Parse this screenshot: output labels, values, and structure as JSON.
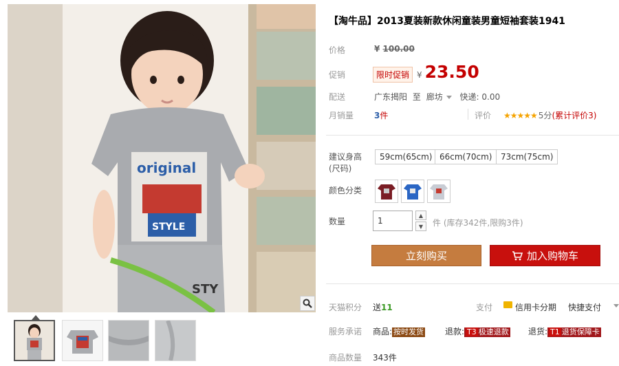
{
  "product": {
    "title": "【淘牛品】2013夏装新款休闲童装男童短袖套装1941"
  },
  "price": {
    "label": "价格",
    "currency": "¥",
    "original": "100.00"
  },
  "promo": {
    "label": "促销",
    "badge": "限时促销",
    "currency": "¥",
    "price": "23.50"
  },
  "shipping": {
    "label": "配送",
    "from": "广东揭阳",
    "to_word": "至",
    "destination": "廊坊",
    "express": "快递: 0.00"
  },
  "sales": {
    "label": "月销量",
    "count": "3",
    "unit": "件",
    "review_label": "评价",
    "stars": "★★★★★",
    "score": "5分",
    "review_count": "(累计评价3)"
  },
  "size": {
    "label": "建议身高(尺码)",
    "options": [
      "59cm(65cm)",
      "66cm(70cm)",
      "73cm(75cm)"
    ]
  },
  "color": {
    "label": "颜色分类",
    "swatches": [
      {
        "name": "maroon-set",
        "color": "#7a1d24"
      },
      {
        "name": "blue-set",
        "color": "#2b66c4"
      },
      {
        "name": "grey-set",
        "color": "#c8ccd4"
      }
    ]
  },
  "quantity": {
    "label": "数量",
    "value": "1",
    "stock": "件 (库存342件,限购3件)"
  },
  "buttons": {
    "buy_now": "立刻购买",
    "add_to_cart": "加入购物车"
  },
  "points": {
    "label": "天猫积分",
    "text": "送",
    "value": "11"
  },
  "payment": {
    "label": "支付",
    "credit": "信用卡分期",
    "quick": "快捷支付"
  },
  "service": {
    "label": "服务承诺",
    "items": [
      {
        "prefix": "商品:",
        "code": "",
        "tag": "按时发货"
      },
      {
        "prefix": "退款:",
        "code": "T3",
        "tag": "极速退款"
      },
      {
        "prefix": "退货:",
        "code": "T1",
        "tag": "退货保障卡"
      }
    ]
  },
  "qty_sold": {
    "label": "商品数量",
    "value": "343件"
  },
  "colors": {
    "price_red": "#c40000",
    "buy_button": "#c57c3f",
    "cart_button": "#c8100d",
    "star": "#f5a300"
  }
}
